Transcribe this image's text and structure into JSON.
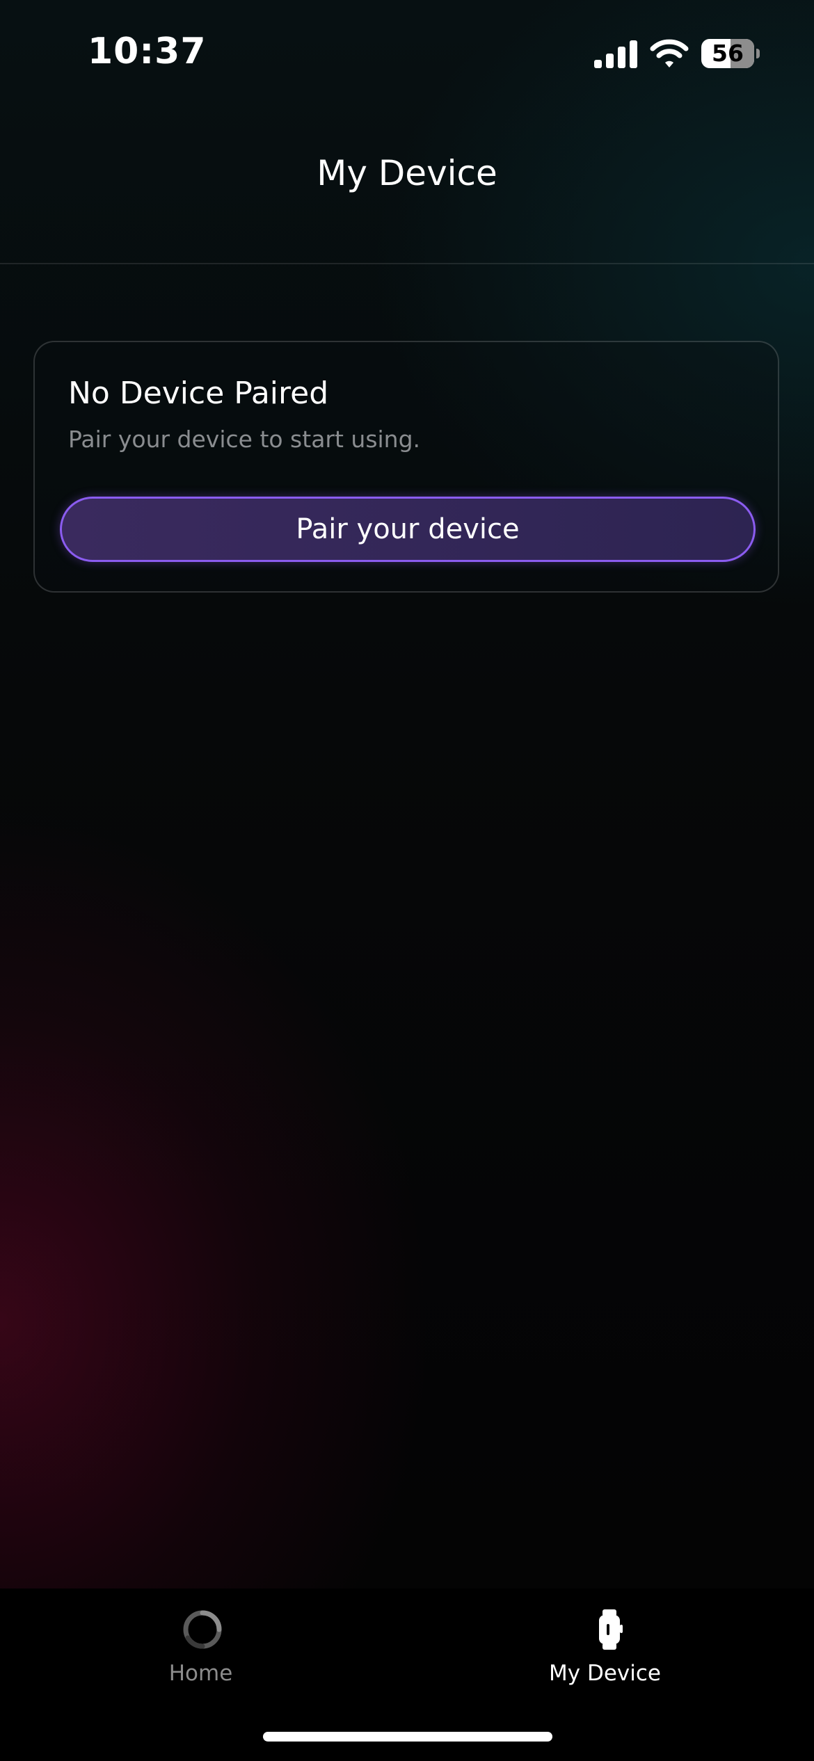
{
  "status_bar": {
    "time": "10:37",
    "battery_level": "56",
    "icons": [
      "signal-icon",
      "wifi-icon",
      "battery-icon"
    ]
  },
  "header": {
    "title": "My Device"
  },
  "device_card": {
    "title": "No Device Paired",
    "subtitle": "Pair your device to start using.",
    "pair_button_label": "Pair your device"
  },
  "tab_bar": {
    "tabs": [
      {
        "label": "Home",
        "icon": "home-ring-icon",
        "active": false
      },
      {
        "label": "My Device",
        "icon": "watch-icon",
        "active": true
      }
    ]
  },
  "colors": {
    "accent": "#8b5cf0",
    "button_fill": "#332659",
    "muted_text": "#8a8d90",
    "inactive_tab": "#8c8c8c"
  }
}
